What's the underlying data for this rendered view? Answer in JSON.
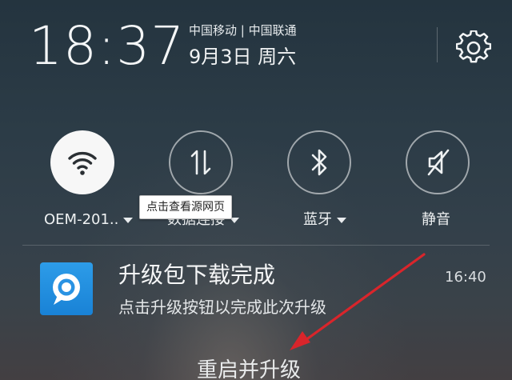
{
  "status": {
    "time": "18:37",
    "carriers": "中国移动 | 中国联通",
    "date": "9月3日 周六"
  },
  "icons": {
    "settings": "gear-icon",
    "wifi": "wifi-icon",
    "data": "data-transfer-icon",
    "bluetooth": "bluetooth-icon",
    "mute": "speaker-muted-icon",
    "app": "chat-bubble-icon"
  },
  "toggles": [
    {
      "label": "OEM-201..",
      "state": "on",
      "has_dropdown": true
    },
    {
      "label": "数据连接",
      "state": "off",
      "has_dropdown": true
    },
    {
      "label": "蓝牙",
      "state": "off",
      "has_dropdown": true
    },
    {
      "label": "静音",
      "state": "off",
      "has_dropdown": false
    }
  ],
  "tooltip": {
    "text": "点击查看源网页"
  },
  "notification": {
    "title": "升级包下载完成",
    "time": "16:40",
    "body": "点击升级按钮以完成此次升级",
    "action_label": "重启并升级"
  },
  "colors": {
    "background": "#2c3c47",
    "toggle_on": "#f7f7f7",
    "app_icon": "#1e8ae0",
    "annotation_arrow": "#d9252b"
  }
}
